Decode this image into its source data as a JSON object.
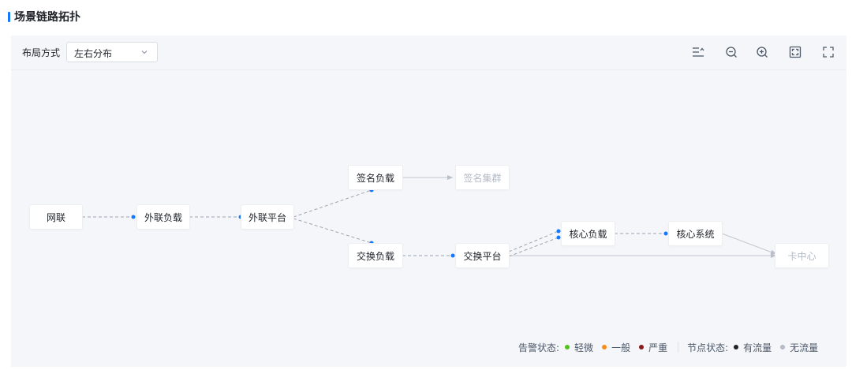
{
  "header": {
    "title": "场景链路拓扑",
    "accent_color": "#1677ff"
  },
  "toolbar": {
    "layout_label": "布局方式",
    "layout_value": "左右分布",
    "tools": [
      {
        "name": "collapse-list-icon"
      },
      {
        "name": "zoom-out-icon"
      },
      {
        "name": "zoom-in-icon"
      },
      {
        "name": "fit-view-icon"
      },
      {
        "name": "fullscreen-icon"
      }
    ]
  },
  "nodes": {
    "wanglian": "网联",
    "wailian_fuzai": "外联负载",
    "wailian_pingtai": "外联平台",
    "qianming_fuzai": "签名负载",
    "qianming_jiqun": "签名集群",
    "jiaohuan_fuzai": "交换负载",
    "jiaohuan_pingtai": "交换平台",
    "hexin_fuzai": "核心负载",
    "hexin_xitong": "核心系统",
    "ka_zhongxin": "卡中心"
  },
  "legend": {
    "alarm_label": "告警状态:",
    "alarm_items": [
      {
        "label": "轻微",
        "color": "#52c41a"
      },
      {
        "label": "一般",
        "color": "#fa8c16"
      },
      {
        "label": "严重",
        "color": "#8b1a1a"
      }
    ],
    "node_label": "节点状态:",
    "node_items": [
      {
        "label": "有流量",
        "color": "#1f2329"
      },
      {
        "label": "无流量",
        "color": "#b3bac5"
      }
    ]
  },
  "colors": {
    "active_edge": "#9aa4b2",
    "inactive_edge": "#c2c8d1",
    "edge_dot": "#1677ff"
  }
}
